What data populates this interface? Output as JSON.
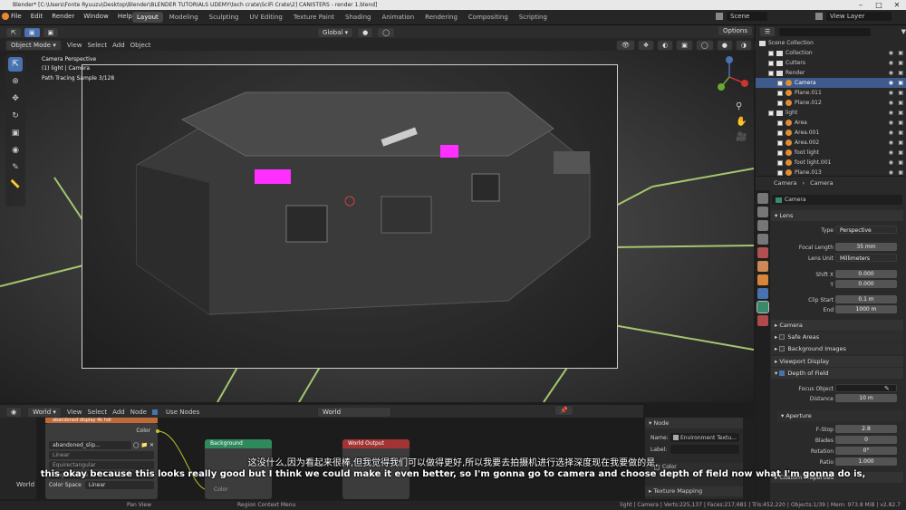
{
  "window": {
    "title": "Blender* [C:\\Users\\Fonte Ryuuzu\\Desktop\\Blender\\BLENDER TUTORIALS UDEMY\\tech crate\\SciFi Crate\\2] CANISTERS - render 1.blend]"
  },
  "menu": [
    "File",
    "Edit",
    "Render",
    "Window",
    "Help"
  ],
  "workspaces": [
    "Layout",
    "Modeling",
    "Sculpting",
    "UV Editing",
    "Texture Paint",
    "Shading",
    "Animation",
    "Rendering",
    "Compositing",
    "Scripting"
  ],
  "active_workspace": "Layout",
  "scene": {
    "label": "Scene",
    "view_layer": "View Layer"
  },
  "viewport": {
    "mode": "Object Mode",
    "menus": [
      "View",
      "Select",
      "Add",
      "Object"
    ],
    "transform": "Global",
    "options": "Options",
    "overlay": {
      "line1": "Camera Perspective",
      "line2": "(1) light | Camera",
      "line3": "Path Tracing Sample 3/128"
    }
  },
  "outliner": {
    "root": "Scene Collection",
    "rows": [
      {
        "label": "Collection",
        "indent": 1,
        "type": "collection",
        "selected": false
      },
      {
        "label": "Cutters",
        "indent": 1,
        "type": "collection",
        "selected": false
      },
      {
        "label": "Render",
        "indent": 1,
        "type": "collection",
        "selected": false
      },
      {
        "label": "Camera",
        "indent": 2,
        "type": "object",
        "selected": true
      },
      {
        "label": "Plane.011",
        "indent": 2,
        "type": "object",
        "selected": false
      },
      {
        "label": "Plane.012",
        "indent": 2,
        "type": "object",
        "selected": false
      },
      {
        "label": "light",
        "indent": 1,
        "type": "collection",
        "selected": false
      },
      {
        "label": "Area",
        "indent": 2,
        "type": "object",
        "selected": false
      },
      {
        "label": "Area.001",
        "indent": 2,
        "type": "object",
        "selected": false
      },
      {
        "label": "Area.002",
        "indent": 2,
        "type": "object",
        "selected": false
      },
      {
        "label": "foot light",
        "indent": 2,
        "type": "object",
        "selected": false
      },
      {
        "label": "foot light.001",
        "indent": 2,
        "type": "object",
        "selected": false
      },
      {
        "label": "Plane.013",
        "indent": 2,
        "type": "object",
        "selected": false
      }
    ]
  },
  "properties": {
    "breadcrumb_left": "Camera",
    "breadcrumb_right": "Camera",
    "datablock": "Camera",
    "lens_panel": "Lens",
    "type_label": "Type",
    "type_value": "Perspective",
    "focal_label": "Focal Length",
    "focal_value": "35 mm",
    "lens_unit_label": "Lens Unit",
    "lens_unit_value": "Millimeters",
    "shiftx_label": "Shift X",
    "shiftx_value": "0.000",
    "y_label": "Y",
    "y_value": "0.000",
    "clip_start_label": "Clip Start",
    "clip_start_value": "0.1 m",
    "end_label": "End",
    "end_value": "1000 m",
    "camera_panel": "Camera",
    "safe_areas": "Safe Areas",
    "background_images": "Background Images",
    "viewport_display": "Viewport Display",
    "dof": "Depth of Field",
    "focus_object_label": "Focus Object",
    "distance_label": "Distance",
    "distance_value": "10 m",
    "aperture": "Aperture",
    "fstop_label": "F-Stop",
    "fstop_value": "2.8",
    "blades_label": "Blades",
    "blades_value": "0",
    "rotation_label": "Rotation",
    "rotation_value": "0°",
    "ratio_label": "Ratio",
    "ratio_value": "1.000",
    "custom_props": "Custom Properties"
  },
  "node_editor": {
    "world": "World",
    "menus": [
      "View",
      "Select",
      "Add",
      "Node"
    ],
    "use_nodes": "Use Nodes",
    "world_name": "World",
    "tex_node": {
      "title": "Environment Texture",
      "output": "Color",
      "image": "abandoned_slip...",
      "interp": "Linear",
      "proj": "Equirectangular",
      "ext": "Single Image",
      "colorspace_label": "Color Space",
      "colorspace_value": "Linear"
    },
    "bg_node": {
      "title": "Background",
      "row": "Color"
    },
    "out_node": {
      "title": "World Output"
    },
    "frame_label": "abandoned display 4k hdr",
    "left_label": "World"
  },
  "node_panel": {
    "header": "Node",
    "name_label": "Name:",
    "name_value": "Environment Textu...",
    "label_label": "Label:",
    "color_label": "Color",
    "texture_mapping": "Texture Mapping"
  },
  "status": {
    "left": "Pan View",
    "center": "Region Context Menu",
    "right": "light | Camera | Verts:225,137 | Faces:217,681 | Tris:452,220 | Objects:1/39 | Mem: 973.8 MiB | v2.82.7"
  },
  "subtitles": {
    "cn": "这没什么,因为看起来很棒,但我觉得我们可以做得更好,所以我要去拍摄机进行选择深度现在我要做的是,",
    "en": "this okay because this looks really good but I think we could make it even better, so I'm gonna go to camera and choose depth of field now what I'm gonna do is,"
  },
  "colors": {
    "accent": "#4a72b0",
    "grid_glow": "#b8e07a",
    "emission": "#ff30ff",
    "bg_node": "#2e8a5c",
    "out_node": "#a33434",
    "tex_node": "#c06a3a"
  }
}
